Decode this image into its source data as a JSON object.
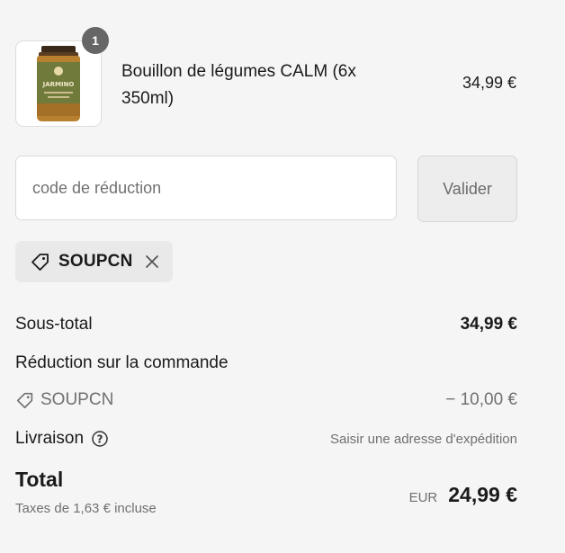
{
  "product": {
    "quantity": "1",
    "name": "Bouillon de légumes CALM (6x 350ml)",
    "price": "34,99 €",
    "brand": "JARMINO",
    "image_icon": "soup-jar-image"
  },
  "discount": {
    "placeholder": "code de réduction",
    "apply_label": "Valider",
    "applied_code": "SOUPCN"
  },
  "summary": {
    "subtotal_label": "Sous-total",
    "subtotal_value": "34,99 €",
    "order_discount_label": "Réduction sur la commande",
    "discount_code": "SOUPCN",
    "discount_value": "− 10,00 €",
    "shipping_label": "Livraison",
    "shipping_value": "Saisir une adresse d'expédition",
    "total_label": "Total",
    "tax_note": "Taxes de 1,63 € incluse",
    "currency": "EUR",
    "total_value": "24,99 €"
  },
  "colors": {
    "background": "#f5f5f5",
    "badge": "#666666",
    "muted_text": "#707070",
    "tag_background": "#e9e9e9"
  }
}
